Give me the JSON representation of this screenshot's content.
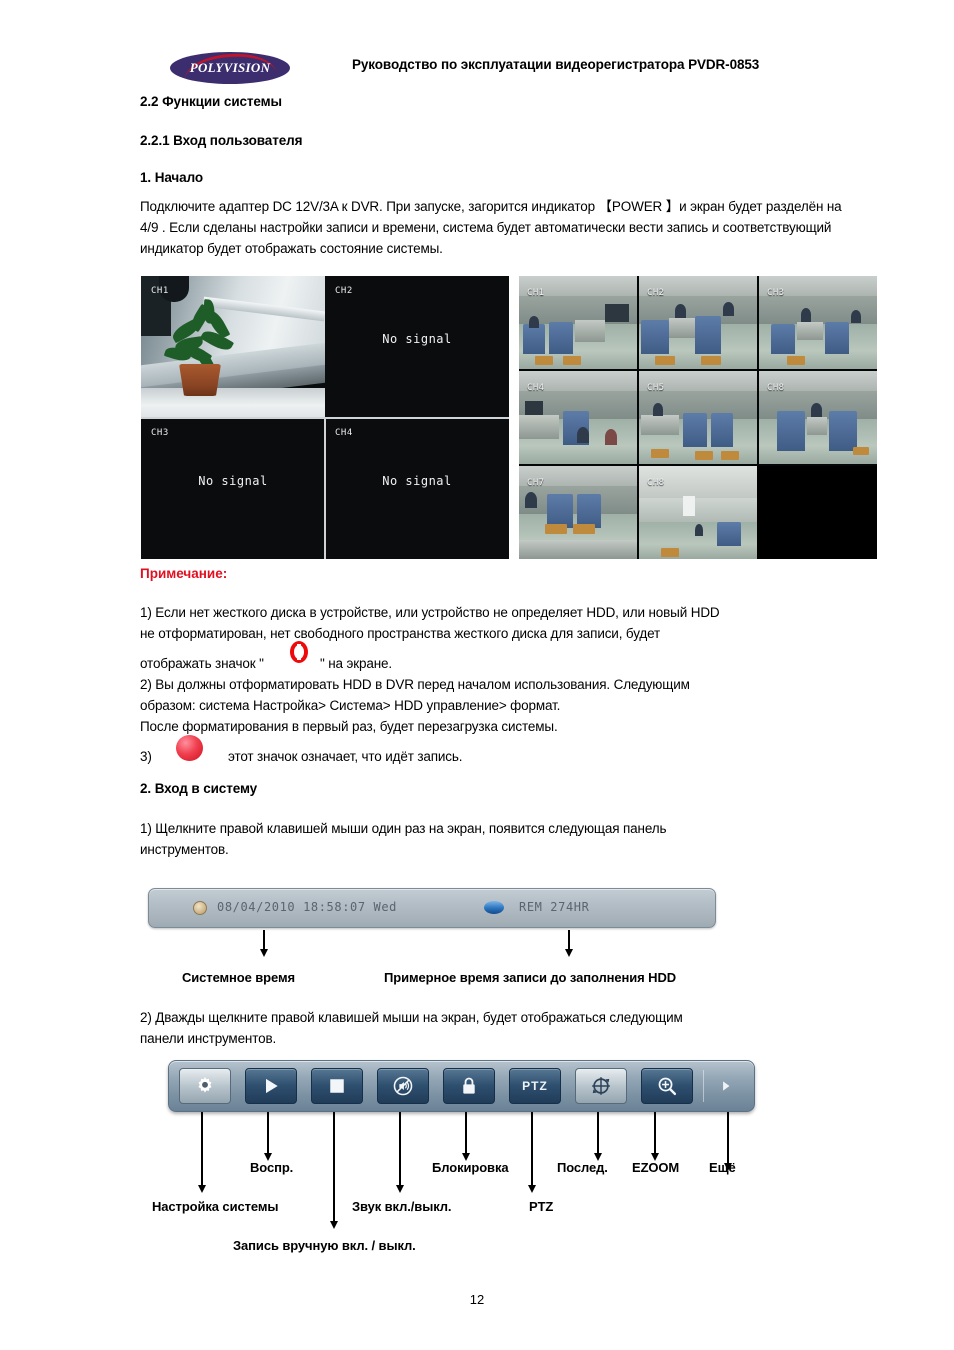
{
  "header": {
    "logo_text": "POLYVISION",
    "title": "Руководство по эксплуатации видеорегистратора PVDR-0853"
  },
  "sections": {
    "s22": "2.2 Функции системы",
    "s221": "2.2.1 Вход пользователя",
    "start_heading": "1. Начало",
    "start_para": "Подключите адаптер DC 12V/3A к DVR. При запуске, загорится индикатор 【POWER 】и экран будет разделён на 4/9 . Если сделаны настройки записи и времени, система будет автоматически вести запись и соответствующий индикатор будет отображать состояние системы.",
    "note_heading": "Примечание:",
    "note1_a": "1) Если нет жесткого диска в устройстве, или устройство не определяет HDD, или новый HDD",
    "note1_b": "не отформатирован, нет свободного пространства жесткого диска для записи,  будет",
    "note1_c_before": "отображать значок \"",
    "note1_c_after": "\" на экране.",
    "note2_a": "2) Вы должны отформатировать HDD в DVR перед началом использования. Следующим",
    "note2_b": "образом: система Настройка> Система> HDD управление> формат.",
    "note2_c": "После форматирования в первый раз, будет перезагрузка системы.",
    "note3_num": "3)",
    "note3_text": "этот значок означает, что идёт запись.",
    "login_heading": "2.  Вход в систему",
    "login_1a": "1) Щелкните правой клавишей мыши один раз на экран, появится следующая панель",
    "login_1b": "инструментов.",
    "login_2a": "2) Дважды щелкните правой клавишей мыши на экран, будет отображаться следующим",
    "login_2b": "панели инструментов."
  },
  "quad_view": {
    "channels": [
      {
        "label": "CH1",
        "status": ""
      },
      {
        "label": "CH2",
        "status": "No signal"
      },
      {
        "label": "CH3",
        "status": "No signal"
      },
      {
        "label": "CH4",
        "status": "No signal"
      }
    ]
  },
  "nine_view": {
    "channels": [
      "CH1",
      "CH2",
      "CH3",
      "CH4",
      "CH5",
      "CH8",
      "CH7",
      "CH8"
    ]
  },
  "status_bar": {
    "datetime": "08/04/2010 18:58:07 Wed",
    "remaining": "REM  274HR",
    "clock_icon": "clock-icon",
    "disk_icon": "disk-icon",
    "callouts": {
      "system_time": "Системное время",
      "record_time": "Примерное время записи до заполнения  HDD"
    }
  },
  "toolbar": {
    "buttons": [
      {
        "id": "settings",
        "icon": "gear-icon",
        "label": "",
        "selected": true
      },
      {
        "id": "play",
        "icon": "play-icon",
        "label": "",
        "selected": false
      },
      {
        "id": "record",
        "icon": "stop-square-icon",
        "label": "",
        "selected": false
      },
      {
        "id": "audio",
        "icon": "speaker-mute-icon",
        "label": "",
        "selected": false
      },
      {
        "id": "lock",
        "icon": "lock-icon",
        "label": "",
        "selected": false
      },
      {
        "id": "ptz",
        "icon": "ptz-text-icon",
        "label": "PTZ",
        "selected": false
      },
      {
        "id": "sequence",
        "icon": "sequence-icon",
        "label": "",
        "selected": true
      },
      {
        "id": "ezoom",
        "icon": "magnifier-plus-icon",
        "label": "",
        "selected": false
      }
    ],
    "more_icon": "chevron-right-icon",
    "callouts": {
      "settings": "Настройка системы",
      "play": "Воспр.",
      "record": "Запись вручную вкл. / выкл.",
      "audio": "Звук вкл./выкл.",
      "lock": "Блокировка",
      "ptz": "PTZ",
      "sequence": "Послед.",
      "ezoom": "EZOOM",
      "more": "Ещё"
    }
  },
  "icons": {
    "hdd_missing": "hdd-missing-icon",
    "recording": "recording-icon"
  },
  "footer": {
    "page_number": "12"
  }
}
